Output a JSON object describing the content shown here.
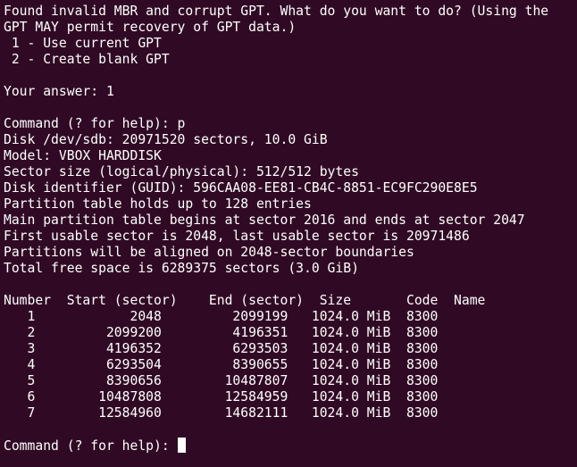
{
  "terminal": {
    "lines": [
      "Found invalid MBR and corrupt GPT. What do you want to do? (Using the",
      "GPT MAY permit recovery of GPT data.)",
      " 1 - Use current GPT",
      " 2 - Create blank GPT",
      "",
      "Your answer: 1",
      "",
      "Command (? for help): p",
      "Disk /dev/sdb: 20971520 sectors, 10.0 GiB",
      "Model: VBOX HARDDISK",
      "Sector size (logical/physical): 512/512 bytes",
      "Disk identifier (GUID): 596CAA08-EE81-CB4C-8851-EC9FC290E8E5",
      "Partition table holds up to 128 entries",
      "Main partition table begins at sector 2016 and ends at sector 2047",
      "First usable sector is 2048, last usable sector is 20971486",
      "Partitions will be aligned on 2048-sector boundaries",
      "Total free space is 6289375 sectors (3.0 GiB)",
      "",
      "Number  Start (sector)    End (sector)  Size       Code  Name",
      "   1            2048         2099199   1024.0 MiB  8300  ",
      "   2         2099200         4196351   1024.0 MiB  8300  ",
      "   3         4196352         6293503   1024.0 MiB  8300  ",
      "   4         6293504         8390655   1024.0 MiB  8300  ",
      "   5         8390656        10487807   1024.0 MiB  8300  ",
      "   6        10487808        12584959   1024.0 MiB  8300  ",
      "   7        12584960        14682111   1024.0 MiB  8300  ",
      ""
    ],
    "prompt": "Command (? for help): ",
    "colors": {
      "background": "#300a24",
      "foreground": "#ffffff"
    }
  }
}
